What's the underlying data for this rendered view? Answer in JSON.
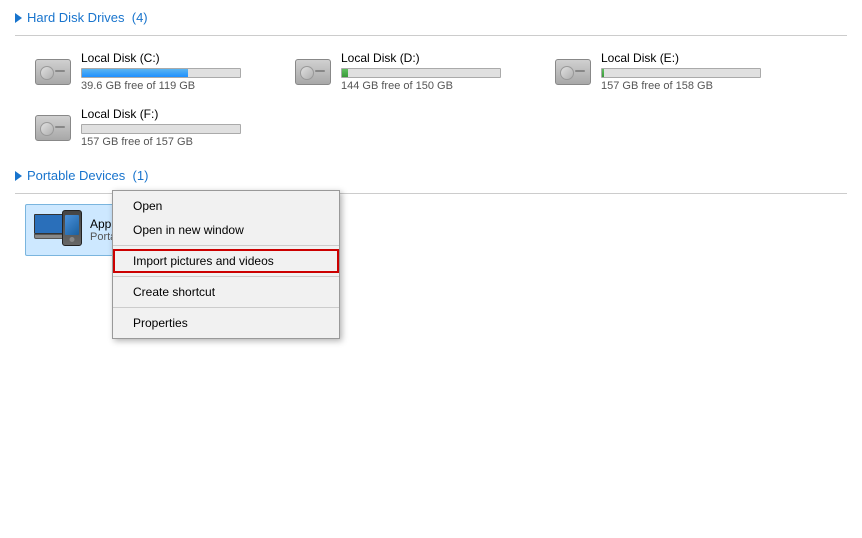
{
  "hardDiskSection": {
    "title": "Hard Disk Drives",
    "count": "(4)",
    "drives": [
      {
        "name": "Local Disk (C:)",
        "freeSpace": "39.6 GB free of 119 GB",
        "usedPercent": 67,
        "letter": "C"
      },
      {
        "name": "Local Disk (D:)",
        "freeSpace": "144 GB free of 150 GB",
        "usedPercent": 4,
        "letter": "D"
      },
      {
        "name": "Local Disk (E:)",
        "freeSpace": "157 GB free of 158 GB",
        "usedPercent": 1,
        "letter": "E"
      },
      {
        "name": "Local Disk (F:)",
        "freeSpace": "157 GB free of 157 GB",
        "usedPercent": 0,
        "letter": "F"
      }
    ]
  },
  "portableSection": {
    "title": "Portable Devices",
    "count": "(1)",
    "devices": [
      {
        "name": "Apple iPhone",
        "sub": "Portable Media Player"
      }
    ]
  },
  "contextMenu": {
    "items": [
      {
        "label": "Open",
        "separator_after": false
      },
      {
        "label": "Open in new window",
        "separator_after": true
      },
      {
        "label": "Import pictures and videos",
        "separator_after": false,
        "highlighted": true
      },
      {
        "label": "Create shortcut",
        "separator_after": false
      },
      {
        "label": "Properties",
        "separator_after": false
      }
    ]
  }
}
